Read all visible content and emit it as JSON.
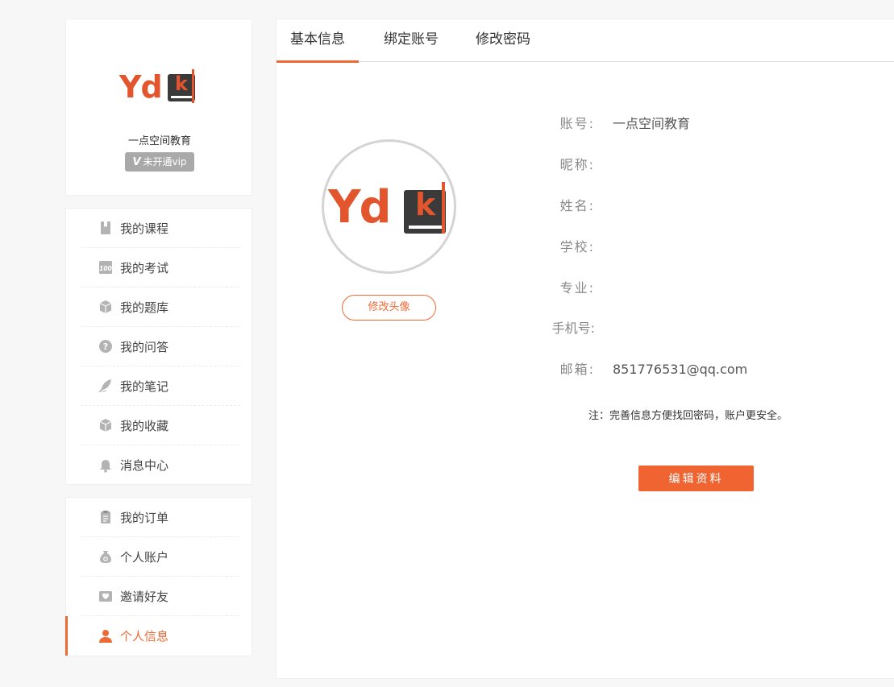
{
  "profile": {
    "logo_text": "Yd",
    "name": "一点空间教育",
    "vip_label": "未开通vip"
  },
  "menu_group_1": [
    {
      "label": "我的课程",
      "icon": "bookmark-icon"
    },
    {
      "label": "我的考试",
      "icon": "exam-100-icon"
    },
    {
      "label": "我的题库",
      "icon": "cube-icon"
    },
    {
      "label": "我的问答",
      "icon": "question-icon"
    },
    {
      "label": "我的笔记",
      "icon": "feather-pen-icon"
    },
    {
      "label": "我的收藏",
      "icon": "box-icon"
    },
    {
      "label": "消息中心",
      "icon": "bell-icon"
    }
  ],
  "menu_group_2": [
    {
      "label": "我的订单",
      "icon": "clipboard-icon"
    },
    {
      "label": "个人账户",
      "icon": "money-bag-icon"
    },
    {
      "label": "邀请好友",
      "icon": "envelope-heart-icon"
    },
    {
      "label": "个人信息",
      "icon": "user-icon",
      "active": true
    }
  ],
  "tabs": [
    "基本信息",
    "绑定账号",
    "修改密码"
  ],
  "avatar": {
    "logo_text": "Yd",
    "change_label": "修改头像"
  },
  "info": {
    "account": {
      "label": "账号:",
      "value": "一点空间教育"
    },
    "nickname": {
      "label": "昵称:",
      "value": ""
    },
    "realname": {
      "label": "姓名:",
      "value": ""
    },
    "school": {
      "label": "学校:",
      "value": ""
    },
    "major": {
      "label": "专业:",
      "value": ""
    },
    "phone": {
      "label": "手机号:",
      "value": ""
    },
    "email": {
      "label": "邮箱:",
      "value": "851776531@qq.com"
    }
  },
  "note": "注：完善信息方便找回密码，账户更安全。",
  "edit_label": "编辑资料",
  "colors": {
    "accent": "#ee6a35",
    "logo_orange": "#e2552d",
    "book_dark": "#3a3a3a",
    "vip_gray": "#a9a9a9"
  }
}
